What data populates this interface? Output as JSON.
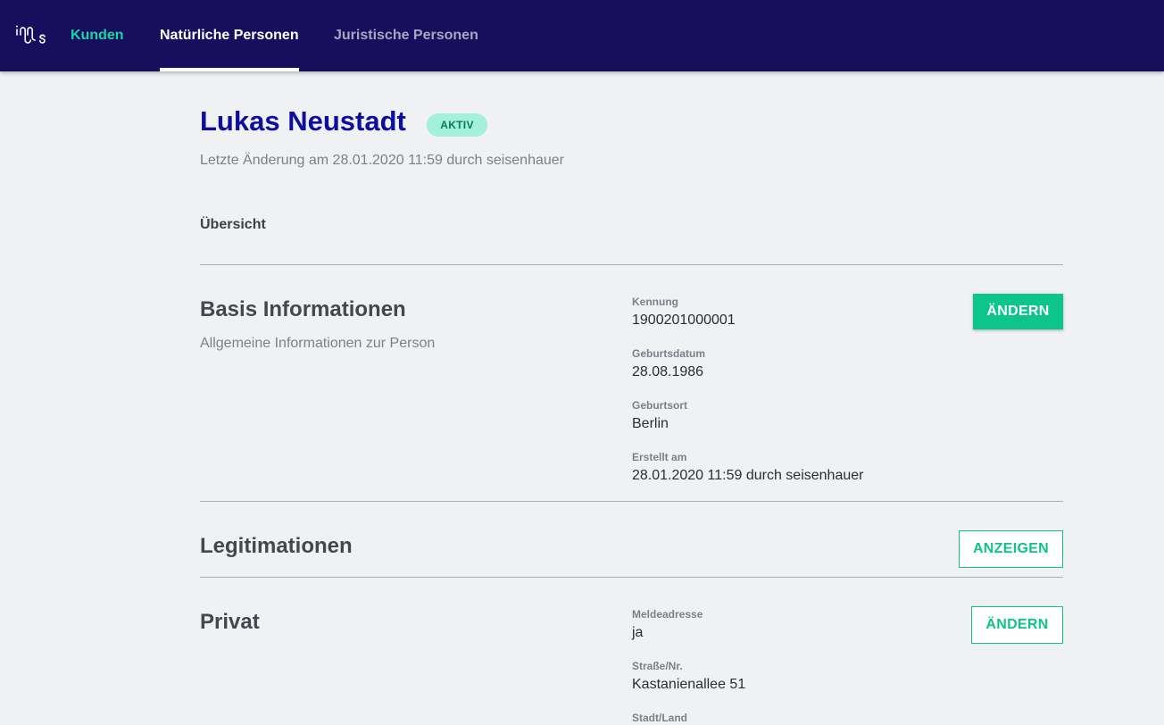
{
  "nav": {
    "logo_text": "innos",
    "tabs": [
      {
        "label": "Kunden"
      },
      {
        "label": "Natürliche Personen",
        "active": true
      },
      {
        "label": "Juristische Personen"
      }
    ]
  },
  "person": {
    "name": "Lukas Neustadt",
    "status": "AKTIV",
    "last_change": "Letzte Änderung am 28.01.2020 11:59 durch seisenhauer"
  },
  "overview_label": "Übersicht",
  "sections": {
    "basis": {
      "title": "Basis Informationen",
      "subtitle": "Allgemeine Informationen zur Person",
      "button": "ÄNDERN",
      "fields": [
        {
          "label": "Kennung",
          "value": "1900201000001"
        },
        {
          "label": "Geburtsdatum",
          "value": "28.08.1986"
        },
        {
          "label": "Geburtsort",
          "value": "Berlin"
        },
        {
          "label": "Erstellt am",
          "value": "28.01.2020 11:59 durch seisenhauer"
        }
      ]
    },
    "legitimationen": {
      "title": "Legitimationen",
      "button": "ANZEIGEN"
    },
    "privat": {
      "title": "Privat",
      "button": "ÄNDERN",
      "fields": [
        {
          "label": "Meldeadresse",
          "value": "ja"
        },
        {
          "label": "Straße/Nr.",
          "value": "Kastanienallee 51"
        },
        {
          "label": "Stadt/Land",
          "value": ""
        }
      ]
    }
  },
  "colors": {
    "nav_bg": "#170f5e",
    "accent": "#0dc48a",
    "name": "#0d0d9e",
    "badge_bg": "#a3f1d8",
    "page_bg": "#f0f1f3"
  }
}
